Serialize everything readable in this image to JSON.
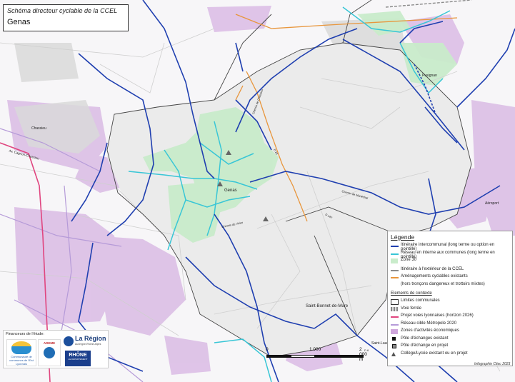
{
  "title": {
    "line1": "Schéma directeur cyclable de la CCEL",
    "line2": "Genas"
  },
  "places": [
    {
      "name": "Genas"
    },
    {
      "name": "Chassieu"
    },
    {
      "name": "Pusignan"
    },
    {
      "name": "Saint-Bonnet-de-Mure"
    },
    {
      "name": "Saint-Laurent"
    },
    {
      "name": "Aéroport"
    }
  ],
  "road_labels": [
    {
      "text": "Chemin de Manéchal"
    },
    {
      "text": "Chemin du Vivier"
    },
    {
      "text": "D 29"
    },
    {
      "text": "D 147"
    },
    {
      "text": "Chemin de Chassieu"
    },
    {
      "text": "Av. Cagnon-Chassieu"
    },
    {
      "text": "D 6"
    }
  ],
  "legend": {
    "title": "Légende",
    "items": [
      {
        "label": "Itinéraire intercommunal (long terme ou option en pointillé)",
        "color": "#1f3fb0"
      },
      {
        "label": "Réseau en interne aux communes (long terme en pointillé)",
        "color": "#38c6d6"
      },
      {
        "label": "Zone 30",
        "color": "#c9eccb"
      },
      {
        "label": "Itinéraire à l'extérieur de la CCEL",
        "color": "#8a8a8a"
      },
      {
        "label": "Aménagements cyclables existants",
        "label2": "(hors tronçons dangereux et trottoirs mixtes)",
        "color": "#e8963c"
      }
    ],
    "context_title": "Elements de contexte",
    "context_items": [
      {
        "label": "Limites communales"
      },
      {
        "label": "Voie ferrée"
      },
      {
        "label": "Projet voies lyonnaises (horizon 2026)",
        "color": "#e0457f"
      },
      {
        "label": "Réseau cible Métropole 2020",
        "color": "#b59ad8"
      },
      {
        "label": "Zones d'activités économiques",
        "color": "#cfa6dc"
      },
      {
        "label": "Pôle d'échanges existant"
      },
      {
        "label": "Pôle d'échange en projet"
      },
      {
        "label": "Collège/Lycée existant ou en projet"
      }
    ]
  },
  "funders": {
    "title": "Financeurs de l'étude:",
    "logos": [
      {
        "text": "Communauté de communes de l'Est Lyonnais"
      },
      {
        "text": "ADEME"
      },
      {
        "text": "La Région"
      },
      {
        "text": "Auvergne-Rhône-Alpes"
      },
      {
        "text": "RHÔNE"
      },
      {
        "text": "LE DÉPARTEMENT"
      }
    ]
  },
  "scale": {
    "zero": "0",
    "mid": "1 000",
    "end": "2 000 m"
  },
  "credit": "Infographie Citec 2023"
}
